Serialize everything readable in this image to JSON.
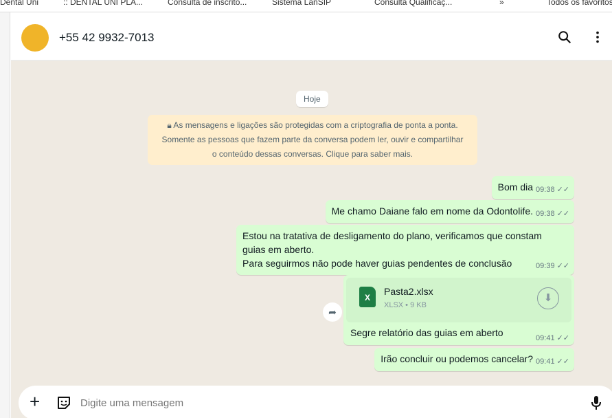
{
  "bookmarks": [
    "Dental Uni",
    ":: DENTAL UNI PLA...",
    "Consulta de inscrito...",
    "Sistema LanSIP",
    "Consulta Qualificaç...",
    "»",
    "Todos os favoritos"
  ],
  "header": {
    "contact": "+55 42 9932-7013"
  },
  "chat": {
    "date_badge": "Hoje",
    "encryption_notice": [
      "As mensagens e ligações são protegidas com a criptografia de ponta a ponta.",
      "Somente as pessoas que fazem parte da conversa podem ler, ouvir e compartilhar",
      "o conteúdo dessas conversas. Clique para saber mais."
    ],
    "messages": [
      {
        "text": "Bom dia",
        "time": "09:38"
      },
      {
        "text": "Me chamo Daiane falo em nome da Odontolife.",
        "time": "09:38"
      },
      {
        "lines": [
          "Estou na tratativa de desligamento do plano, verificamos que constam",
          "guias em aberto.",
          "Para seguirmos não pode haver guias pendentes de conclusão"
        ],
        "time": "09:39"
      },
      {
        "file": {
          "name": "Pasta2.xlsx",
          "info": "XLSX • 9 KB",
          "icon_letter": "X"
        },
        "text": "Segre relatório das guias em aberto",
        "time": "09:41"
      },
      {
        "text": "Irão concluir ou podemos cancelar?",
        "time": "09:41"
      }
    ]
  },
  "composer": {
    "placeholder": "Digite uma mensagem"
  },
  "colors": {
    "bubble": "#d9fdd3",
    "background": "#efeae2",
    "notice": "#ffeecd",
    "excel": "#1e7e45"
  }
}
